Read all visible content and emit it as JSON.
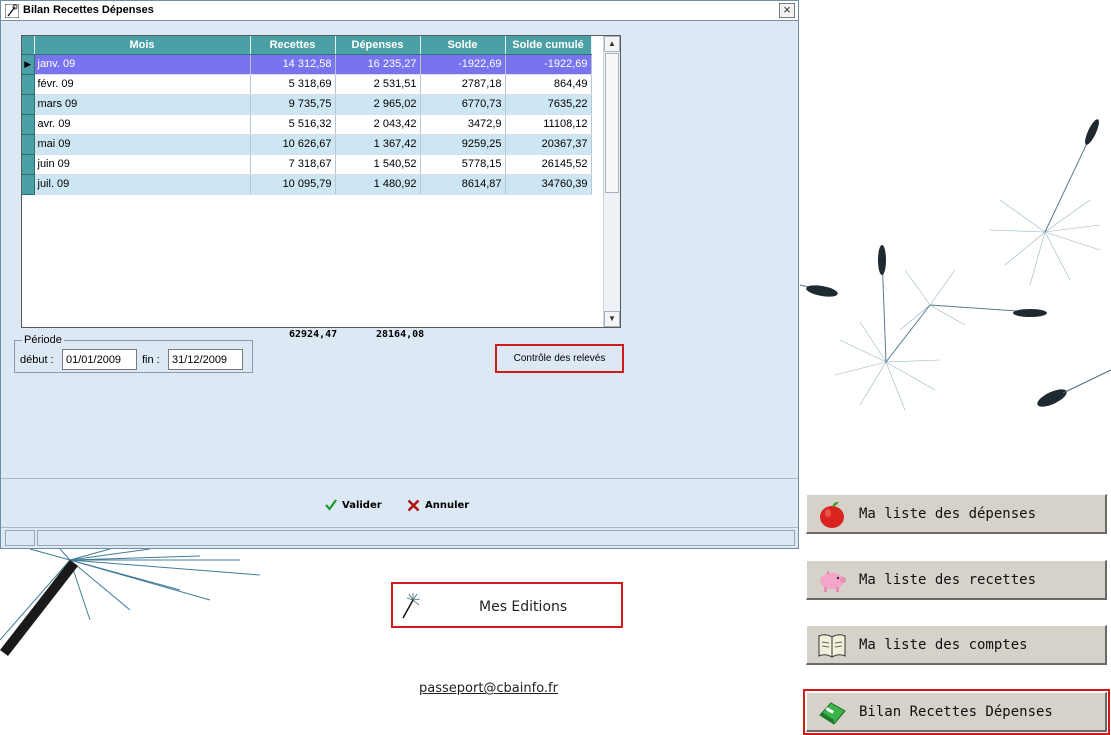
{
  "dialog": {
    "title": "Bilan Recettes Dépenses",
    "close_label": "×"
  },
  "grid": {
    "columns": [
      "Mois",
      "Recettes",
      "Dépenses",
      "Solde",
      "Solde cumulé"
    ],
    "rows": [
      {
        "mois": "janv. 09",
        "recettes": "14 312,58",
        "depenses": "16 235,27",
        "solde": "-1922,69",
        "cumul": "-1922,69",
        "selected": true
      },
      {
        "mois": "févr. 09",
        "recettes": "5 318,69",
        "depenses": "2 531,51",
        "solde": "2787,18",
        "cumul": "864,49"
      },
      {
        "mois": "mars 09",
        "recettes": "9 735,75",
        "depenses": "2 965,02",
        "solde": "6770,73",
        "cumul": "7635,22"
      },
      {
        "mois": "avr. 09",
        "recettes": "5 516,32",
        "depenses": "2 043,42",
        "solde": "3472,9",
        "cumul": "11108,12"
      },
      {
        "mois": "mai 09",
        "recettes": "10 626,67",
        "depenses": "1 367,42",
        "solde": "9259,25",
        "cumul": "20367,37"
      },
      {
        "mois": "juin 09",
        "recettes": "7 318,67",
        "depenses": "1 540,52",
        "solde": "5778,15",
        "cumul": "26145,52"
      },
      {
        "mois": "juil. 09",
        "recettes": "10 095,79",
        "depenses": "1 480,92",
        "solde": "8614,87",
        "cumul": "34760,39"
      }
    ],
    "total_recettes": "62924,47",
    "total_depenses": "28164,08"
  },
  "periode": {
    "legend": "Période",
    "debut_label": "début :",
    "debut_value": "01/01/2009",
    "fin_label": "fin :",
    "fin_value": "31/12/2009"
  },
  "controle_label": "Contrôle des relevés",
  "valider_label": "Valider",
  "annuler_label": "Annuler",
  "menu": [
    {
      "label": "Ma liste des dépenses",
      "icon": "apple-icon"
    },
    {
      "label": "Ma liste des recettes",
      "icon": "piggy-bank-icon"
    },
    {
      "label": "Ma liste des comptes",
      "icon": "book-icon"
    },
    {
      "label": "Bilan Recettes Dépenses",
      "icon": "eraser-icon"
    }
  ],
  "editions_label": "Mes Editions",
  "email": "passeport@cbainfo.fr",
  "colors": {
    "header": "#4aa0a4",
    "selected_row": "#7a73f0",
    "alt_row": "#cde6f3",
    "highlight": "#d21a1a"
  }
}
